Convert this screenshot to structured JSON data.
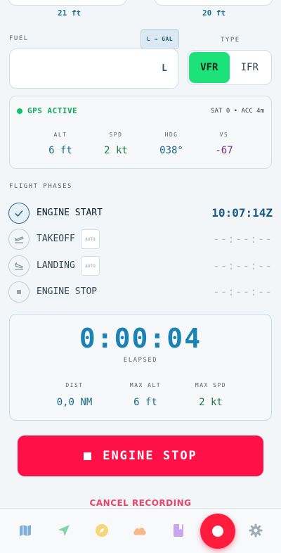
{
  "top": {
    "left_value": "21 ft",
    "right_value": "20 ft"
  },
  "fuel": {
    "label": "FUEL",
    "convert_label": "L → GAL",
    "unit": "L"
  },
  "type": {
    "label": "TYPE",
    "options": [
      "VFR",
      "IFR"
    ],
    "selected": "VFR"
  },
  "gps": {
    "status": "GPS ACTIVE",
    "sat_acc": "SAT 0 • ACC 4m",
    "readouts": [
      {
        "label": "ALT",
        "value": "6 ft"
      },
      {
        "label": "SPD",
        "value": "2 kt"
      },
      {
        "label": "HDG",
        "value": "038°"
      },
      {
        "label": "VS",
        "value": "-67"
      }
    ]
  },
  "phases": {
    "label": "FLIGHT PHASES",
    "items": [
      {
        "name": "ENGINE START",
        "time": "10:07:14Z",
        "done": true,
        "auto": ""
      },
      {
        "name": "TAKEOFF",
        "time": "--:--:--",
        "done": false,
        "auto": "AUTO"
      },
      {
        "name": "LANDING",
        "time": "--:--:--",
        "done": false,
        "auto": "AUTO"
      },
      {
        "name": "ENGINE STOP",
        "time": "--:--:--",
        "done": false,
        "auto": ""
      }
    ]
  },
  "elapsed": {
    "time": "0:00:04",
    "label": "ELAPSED",
    "stats": [
      {
        "label": "DIST",
        "value": "0,0 NM"
      },
      {
        "label": "MAX ALT",
        "value": "6 ft"
      },
      {
        "label": "MAX SPD",
        "value": "2 kt"
      }
    ]
  },
  "actions": {
    "stop_label": "ENGINE STOP",
    "cancel_label": "CANCEL RECORDING"
  },
  "nav": {
    "icons": [
      "map-icon",
      "navigate-icon",
      "compass-icon",
      "cloud-icon",
      "logbook-icon",
      "record-icon",
      "settings-icon"
    ]
  },
  "colors": {
    "accent_red": "#ff1148",
    "vfr_green": "#1de27a",
    "gps_green": "#0eab5c",
    "timer_blue": "#1a82b4"
  }
}
